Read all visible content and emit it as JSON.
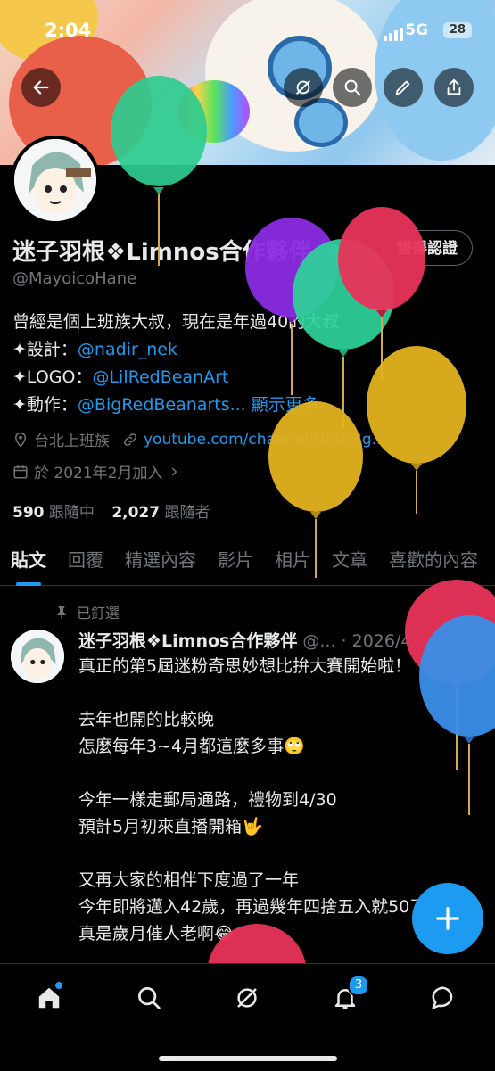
{
  "status_bar": {
    "time": "2:04",
    "network": "5G",
    "battery": "28"
  },
  "profile": {
    "display_name": "迷子羽根❖Limnos合作夥伴",
    "handle": "@MayoicoHane",
    "edit_button": "獲得認證",
    "bio_line1": "曾經是個上班族大叔，現在是年過40的大叔",
    "bio_line2_prefix": "✦設計：",
    "bio_line2_link": "@nadir_nek",
    "bio_line3_prefix": "✦LOGO：",
    "bio_line3_link": "@LilRedBeanArt",
    "bio_line4_prefix": "✦動作：",
    "bio_line4_link": "@BigRedBeanarts...",
    "bio_more": "顯示更多",
    "location": "台北上班族",
    "website": "youtube.com/channel/UCtN3g...",
    "joined": "於 2021年2月加入",
    "following_count": "590",
    "following_label": "跟隨中",
    "followers_count": "2,027",
    "followers_label": "跟隨者"
  },
  "tabs": [
    "貼文",
    "回覆",
    "精選內容",
    "影片",
    "相片",
    "文章",
    "喜歡的內容"
  ],
  "pinned_tweet": {
    "pinned_label": "已釘選",
    "author": "迷子羽根❖Limnos合作夥伴",
    "meta": "@... · 2026/4/...",
    "text": "真正的第5屆迷粉奇思妙想比拚大賽開始啦！\n\n去年也開的比較晚\n怎麼每年3~4月都這麼多事🙄\n\n今年一樣走郵局通路，禮物到4/30\n預計5月初來直播開箱🤟\n\n又再大家的相伴下度過了一年\n今年即將邁入42歲，再過幾年四捨五入就50了\n真是歲月催人老啊😂"
  },
  "nav": {
    "notification_badge": "3"
  },
  "icons": {
    "back": "back-arrow-icon",
    "grok": "grok-icon",
    "search": "search-icon",
    "edit": "pencil-icon",
    "share": "share-icon",
    "location": "location-pin-icon",
    "link": "link-icon",
    "calendar": "calendar-icon",
    "pin": "pin-icon",
    "home": "home-icon",
    "explore": "search-icon",
    "notifications": "bell-icon",
    "messages": "chat-bubble-icon",
    "compose": "plus-icon"
  },
  "colors": {
    "accent": "#1d9bf0",
    "background": "#000000",
    "text": "#e7e9ea",
    "muted": "#71767b"
  }
}
